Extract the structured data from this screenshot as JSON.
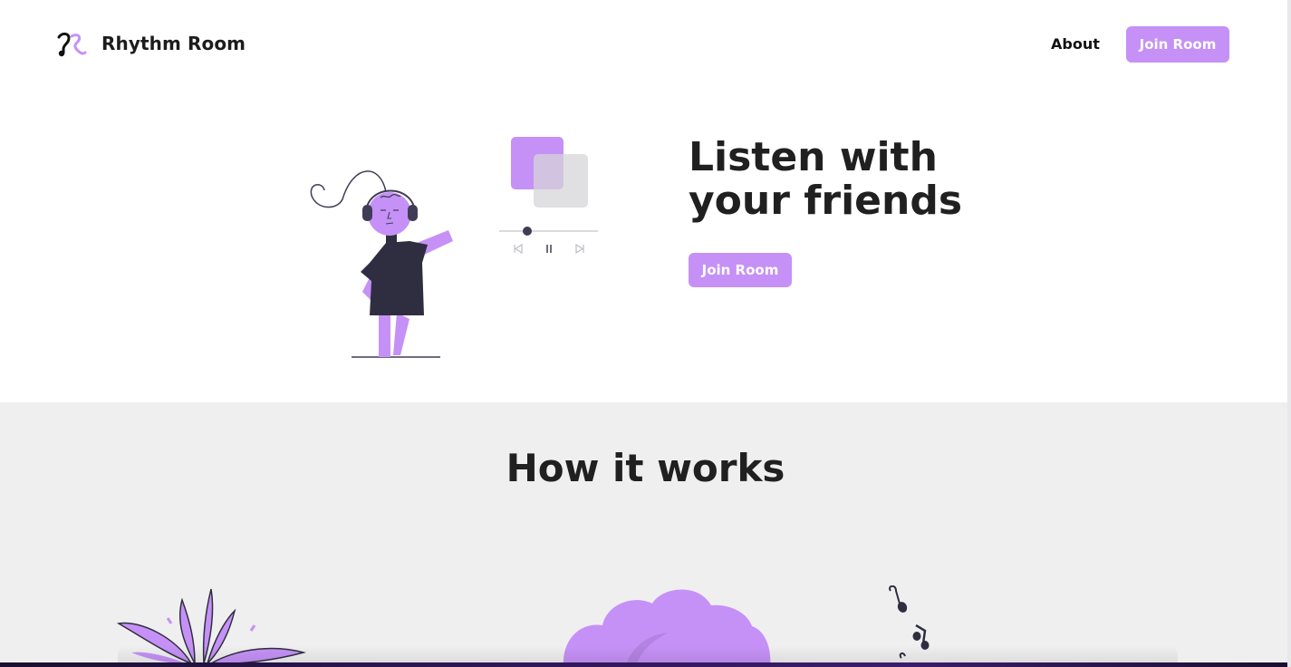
{
  "nav": {
    "brand": "Rhythm Room",
    "logo_icon": "rhythm-room-logo-icon",
    "about_label": "About",
    "join_label": "Join Room"
  },
  "hero": {
    "title_line1": "Listen with",
    "title_line2": "your friends",
    "join_label": "Join Room",
    "illustration": "person-with-headphones-dancing",
    "player_controls": [
      "skip-back-icon",
      "pause-icon",
      "skip-forward-icon"
    ],
    "progress": 0.28
  },
  "how": {
    "title": "How it works",
    "illustrations": [
      "plant-leaves-illustration",
      "cloud-illustration",
      "music-notes-illustration"
    ]
  },
  "colors": {
    "accent": "#c591f6",
    "dark": "#2f2e41",
    "section_bg": "#efeff0",
    "text": "#202020"
  }
}
